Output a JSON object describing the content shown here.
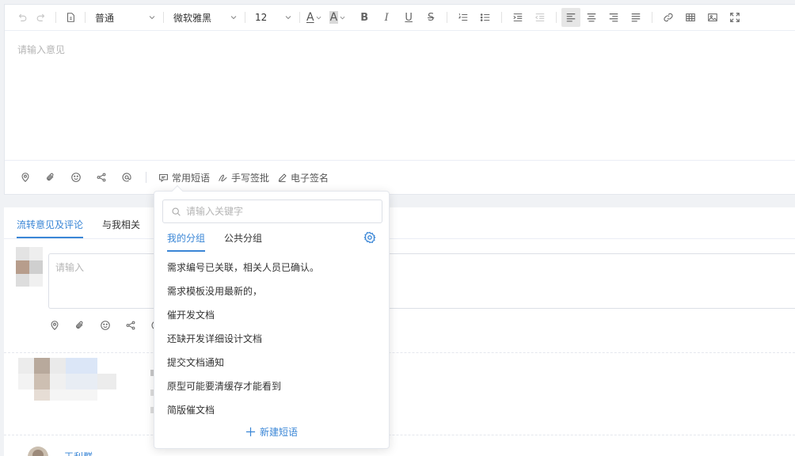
{
  "toolbar": {
    "paragraph_style": "普通",
    "font_family": "微软雅黑",
    "font_size": "12",
    "bold": "B",
    "italic": "I",
    "underline": "U",
    "strike": "S",
    "font_color_glyph": "A",
    "bg_color_glyph": "A"
  },
  "editor": {
    "placeholder": "请输入意见"
  },
  "editor_footer": {
    "phrases_label": "常用短语",
    "handwriting_label": "手写签批",
    "esign_label": "电子签名"
  },
  "comments": {
    "tabs": [
      "流转意见及评论",
      "与我相关"
    ],
    "input_placeholder": "请输入",
    "user_name": "王利群"
  },
  "popover": {
    "search_placeholder": "请输入关键字",
    "tabs": [
      "我的分组",
      "公共分组"
    ],
    "phrases": [
      "需求编号已关联，相关人员已确认。",
      "需求模板没用最新的，",
      "催开发文档",
      "还缺开发详细设计文档",
      "提交文档通知",
      "原型可能要清缓存才能看到",
      "简版催文档"
    ],
    "new_phrase": "新建短语"
  },
  "colors": {
    "accent": "#3a86d6",
    "border": "#e4e7ed"
  }
}
